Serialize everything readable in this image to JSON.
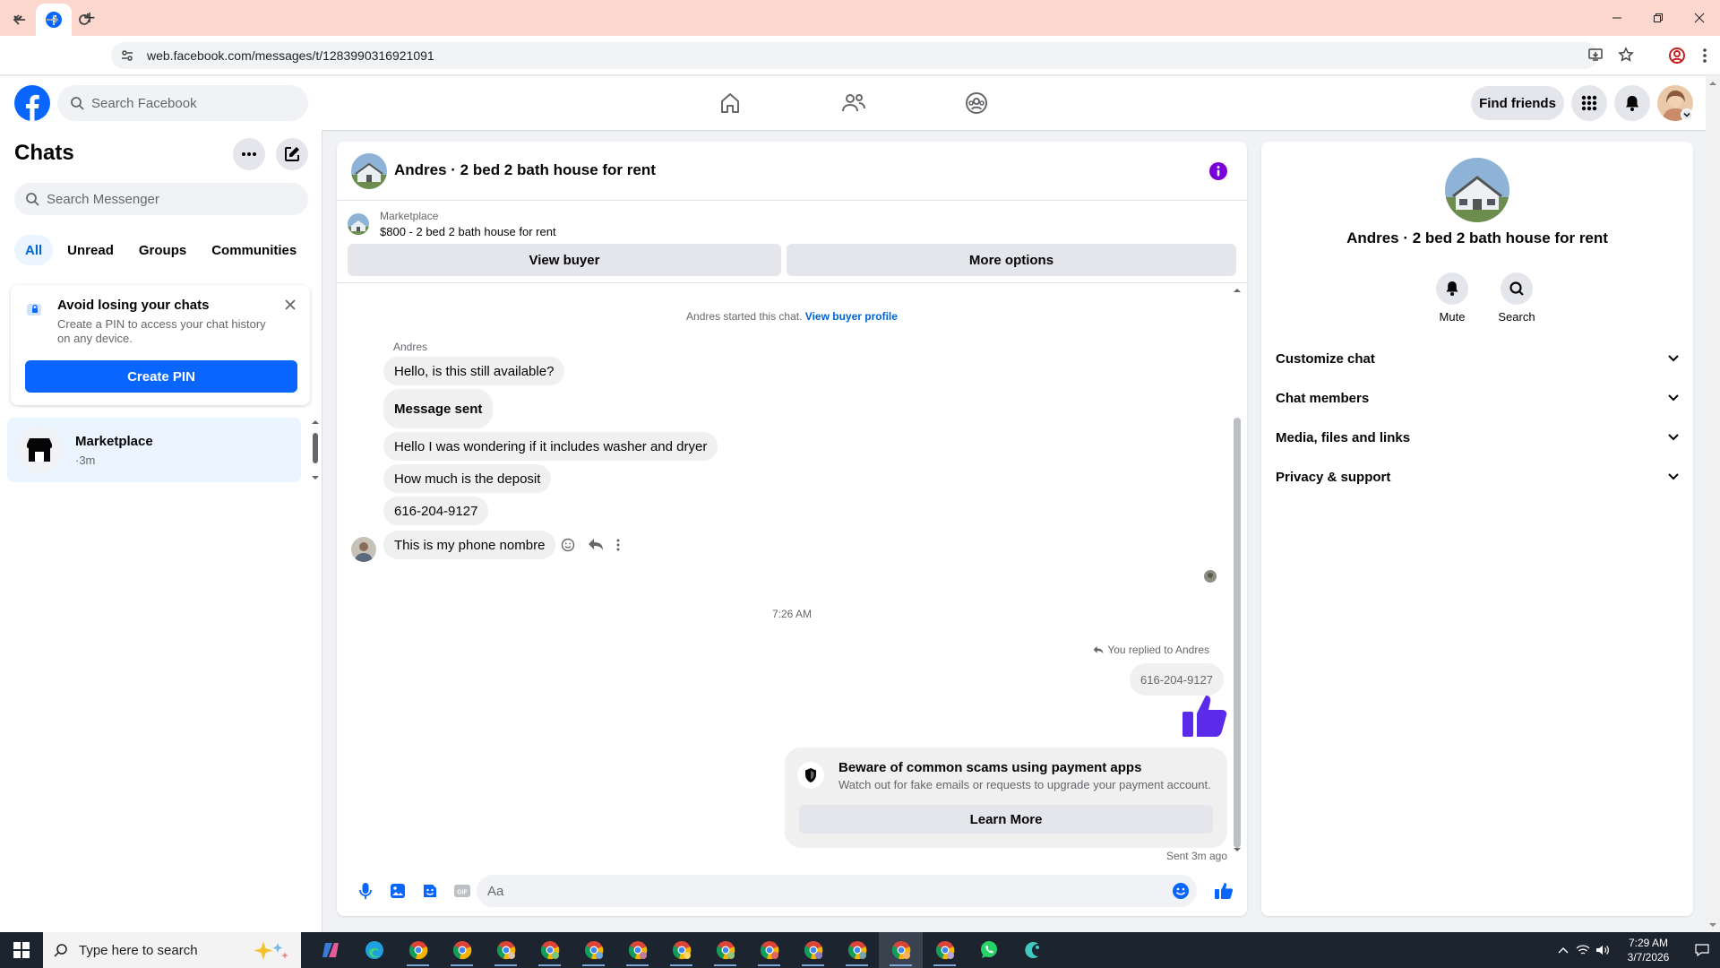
{
  "browser": {
    "url": "web.facebook.com/messages/t/1283990316921091",
    "new_tab_symbol": "+"
  },
  "facebook": {
    "search_placeholder": "Search Facebook",
    "find_friends": "Find friends"
  },
  "chats_panel": {
    "title": "Chats",
    "search_placeholder": "Search Messenger",
    "filters": [
      "All",
      "Unread",
      "Groups",
      "Communities"
    ],
    "pin_card": {
      "title": "Avoid losing your chats",
      "description": "Create a PIN to access your chat history on any device.",
      "button": "Create PIN"
    },
    "chats": [
      {
        "name": "Marketplace",
        "time": "·3m"
      }
    ]
  },
  "conversation": {
    "title": "Andres · 2 bed 2 bath house for rent",
    "marketplace_label": "Marketplace",
    "listing": "$800 - 2 bed 2 bath house for rent",
    "view_buyer": "View buyer",
    "more_options": "More options",
    "started_text": "Andres started this chat.",
    "view_buyer_profile": "View buyer profile",
    "sender_name": "Andres",
    "messages": [
      "Hello, is this still available?",
      "Message sent",
      "Hello I was wondering if it includes washer and dryer",
      "How much is the deposit",
      "616-204-9127",
      "This is my phone nombre"
    ],
    "timestamp": "7:26 AM",
    "replied_text": "You replied to Andres",
    "reply_quote": "616-204-9127",
    "scam_card": {
      "title": "Beware of common scams using payment apps",
      "description": "Watch out for fake emails or requests to upgrade your payment account.",
      "button": "Learn More"
    },
    "sent_status": "Sent 3m ago",
    "composer_placeholder": "Aa"
  },
  "info_panel": {
    "name": "Andres · 2 bed 2 bath house for rent",
    "actions": [
      "Mute",
      "Search"
    ],
    "sections": [
      "Customize chat",
      "Chat members",
      "Media, files and links",
      "Privacy & support"
    ]
  },
  "taskbar": {
    "search_placeholder": "Type here to search",
    "time": "7:29 AM",
    "date": "3/7/2026"
  },
  "colors": {
    "facebook_blue": "#0866ff",
    "messenger_purple": "#5b2bea",
    "browser_tab_bar": "#fbd7cd"
  }
}
